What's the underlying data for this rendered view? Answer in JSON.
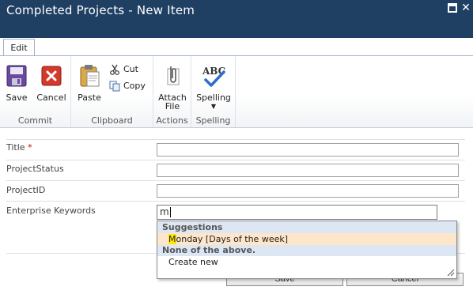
{
  "window": {
    "title": "Completed Projects - New Item"
  },
  "ribbon": {
    "tab_label": "Edit",
    "groups": {
      "commit": {
        "label": "Commit",
        "save": "Save",
        "cancel": "Cancel"
      },
      "clipboard": {
        "label": "Clipboard",
        "paste": "Paste",
        "cut": "Cut",
        "copy": "Copy"
      },
      "actions": {
        "label": "Actions",
        "attach_line1": "Attach",
        "attach_line2": "File"
      },
      "spelling": {
        "label": "Spelling",
        "spelling": "Spelling",
        "icon_text": "ABC"
      }
    }
  },
  "form": {
    "fields": [
      {
        "label": "Title",
        "required_marker": "*",
        "value": ""
      },
      {
        "label": "ProjectStatus",
        "value": ""
      },
      {
        "label": "ProjectID",
        "value": ""
      },
      {
        "label": "Enterprise Keywords",
        "value": "m"
      }
    ],
    "footer": {
      "save": "Save",
      "cancel": "Cancel"
    }
  },
  "suggestions": {
    "header": "Suggestions",
    "item_match": "M",
    "item_rest": "onday [Days of the week]",
    "none_header": "None of the above.",
    "create_new": "Create new"
  },
  "colors": {
    "title_bar": "#1f3f63",
    "suggestion_highlight": "#fde6c9",
    "match_highlight": "#ffe800",
    "required": "#cc0000"
  }
}
